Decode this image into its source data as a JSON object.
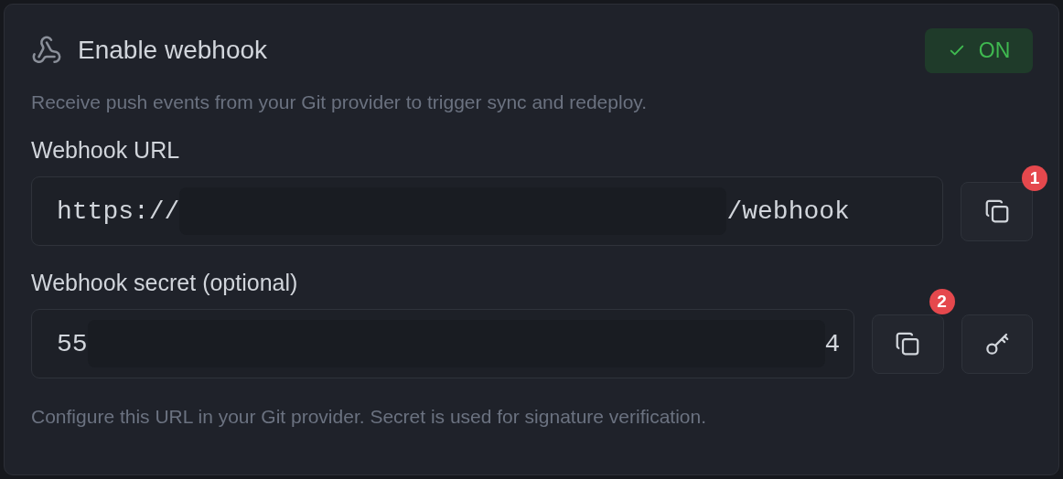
{
  "header": {
    "title": "Enable webhook",
    "toggle": {
      "label": "ON",
      "on": true
    }
  },
  "description": "Receive push events from your Git provider to trigger sync and redeploy.",
  "url": {
    "label": "Webhook URL",
    "value_start": "https://",
    "value_end": "/webhook",
    "badge": "1"
  },
  "secret": {
    "label": "Webhook secret (optional)",
    "value_start": "55",
    "value_end": "4",
    "badge": "2"
  },
  "footer": "Configure this URL in your Git provider. Secret is used for signature verification."
}
